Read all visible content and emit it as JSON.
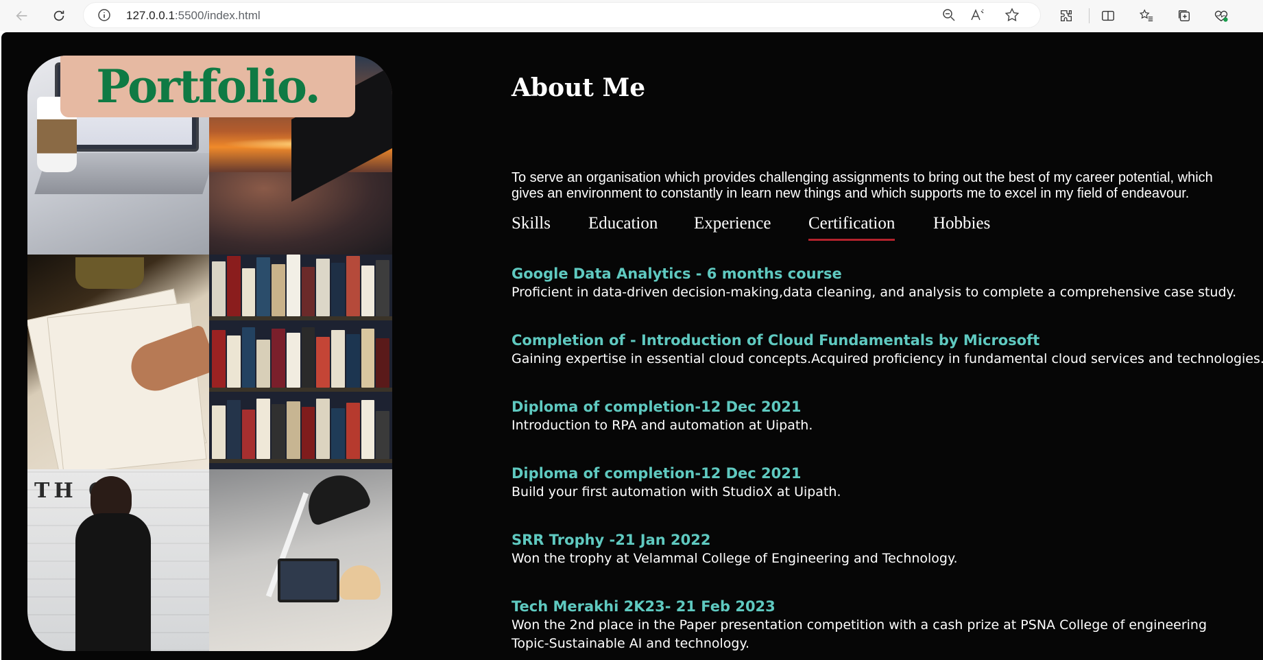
{
  "browser": {
    "url_host": "127.0.0.1",
    "url_path": ":5500/index.html"
  },
  "collage": {
    "banner_text": "Portfolio.",
    "sign_text": "TH      C"
  },
  "about": {
    "title": "About Me",
    "text": "To serve an organisation which provides challenging assignments to bring out the best of my career potential, which gives an environment to constantly in learn new things and which supports me to excel in my field of endeavour."
  },
  "tabs": [
    {
      "label": "Skills",
      "active": false
    },
    {
      "label": "Education",
      "active": false
    },
    {
      "label": "Experience",
      "active": false
    },
    {
      "label": "Certification",
      "active": true
    },
    {
      "label": "Hobbies",
      "active": false
    }
  ],
  "certifications": [
    {
      "title": "Google Data Analytics - 6 months course",
      "desc": [
        "Proficient in data-driven decision-making,data cleaning, and analysis to complete a comprehensive case study."
      ]
    },
    {
      "title": "Completion of - Introduction of Cloud Fundamentals by Microsoft",
      "desc": [
        "Gaining expertise in essential cloud concepts.Acquired proficiency in fundamental cloud services and technologies."
      ]
    },
    {
      "title": "Diploma of completion-12 Dec 2021",
      "desc": [
        "Introduction to RPA and automation at Uipath."
      ]
    },
    {
      "title": "Diploma of completion-12 Dec 2021",
      "desc": [
        "Build your first automation with StudioX at Uipath."
      ]
    },
    {
      "title": "SRR Trophy -21 Jan 2022",
      "desc": [
        "Won the trophy at Velammal College of Engineering and Technology."
      ]
    },
    {
      "title": "Tech Merakhi 2K23- 21 Feb 2023",
      "desc": [
        "Won the 2nd place in the Paper presentation competition with a cash prize at PSNA College of engineering",
        "Topic-Sustainable AI and technology."
      ]
    }
  ],
  "colors": {
    "page_bg": "#060606",
    "cert_title": "#5fc9c0",
    "tab_underline": "#b3222c",
    "banner_bg": "#e6b9a2",
    "banner_text": "#0f7a44"
  }
}
